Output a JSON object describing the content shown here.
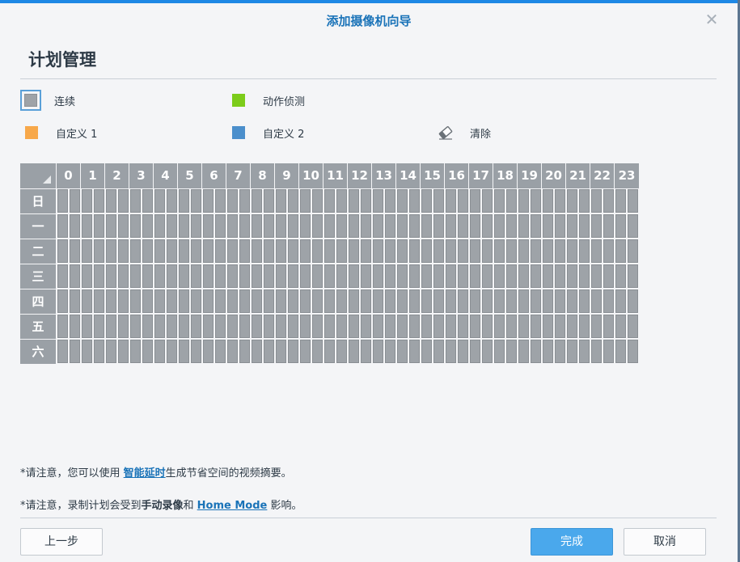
{
  "dialog": {
    "title": "添加摄像机向导",
    "close_label": "✕"
  },
  "section": {
    "title": "计划管理"
  },
  "legend": {
    "continuous": "连续",
    "motion": "动作侦测",
    "custom1": "自定义 1",
    "custom2": "自定义 2",
    "clear": "清除",
    "colors": {
      "continuous": "#9ea3a8",
      "motion": "#7ccc1a",
      "custom1": "#f7a84a",
      "custom2": "#4b8fcc"
    }
  },
  "schedule": {
    "hours": [
      "0",
      "1",
      "2",
      "3",
      "4",
      "5",
      "6",
      "7",
      "8",
      "9",
      "10",
      "11",
      "12",
      "13",
      "14",
      "15",
      "16",
      "17",
      "18",
      "19",
      "20",
      "21",
      "22",
      "23"
    ],
    "days": [
      "日",
      "一",
      "二",
      "三",
      "四",
      "五",
      "六"
    ],
    "slots_per_hour": 2,
    "fill_mode": "continuous"
  },
  "notes": {
    "note1_prefix": "*请注意，您可以使用 ",
    "note1_link": "智能延时",
    "note1_suffix": "生成节省空间的视频摘要。",
    "note2_prefix": "*请注意，录制计划会受到",
    "note2_bold": "手动录像",
    "note2_mid": "和 ",
    "note2_link": "Home Mode",
    "note2_suffix": " 影响。"
  },
  "buttons": {
    "back": "上一步",
    "finish": "完成",
    "cancel": "取消"
  }
}
